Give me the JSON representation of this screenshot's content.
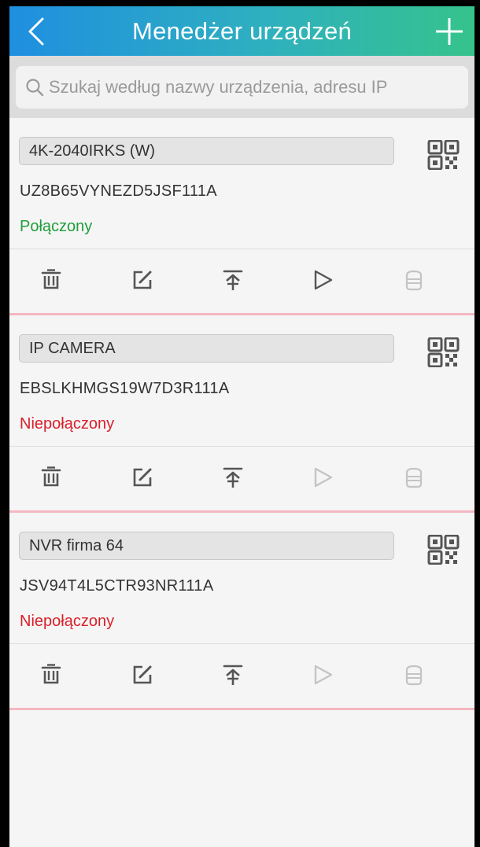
{
  "header": {
    "title": "Menedżer urządzeń",
    "back_icon": "chevron-left-icon",
    "add_icon": "plus-icon"
  },
  "search": {
    "placeholder": "Szukaj według nazwy urządzenia, adresu IP",
    "icon": "search-icon"
  },
  "colors": {
    "header_gradient_start": "#1f8fe0",
    "header_gradient_end": "#36c38c",
    "connected": "#1f9e3a",
    "disconnected": "#d9202a",
    "divider": "#f4b7c1",
    "icon_active": "#555555",
    "icon_disabled": "#c4c4c4"
  },
  "devices": [
    {
      "name": "4K-2040IRKS (W)",
      "serial": "UZ8B65VYNEZD5JSF111A",
      "status": "Połączony",
      "connected": true
    },
    {
      "name": "IP CAMERA",
      "serial": "EBSLKHMGS19W7D3R111A",
      "status": "Niepołączony",
      "connected": false
    },
    {
      "name": "NVR firma 64",
      "serial": "JSV94T4L5CTR93NR111A",
      "status": "Niepołączony",
      "connected": false
    }
  ],
  "actions": [
    "trash-icon",
    "edit-icon",
    "upload-icon",
    "play-icon",
    "storage-icon"
  ]
}
